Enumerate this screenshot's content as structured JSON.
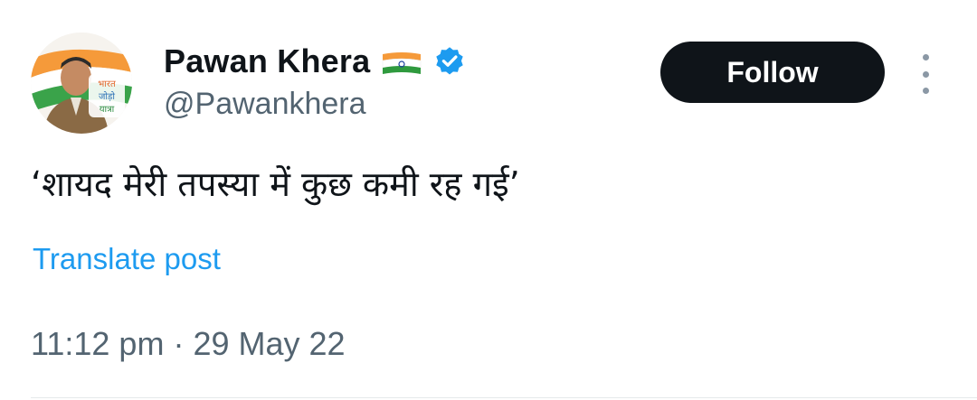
{
  "author": {
    "display_name": "Pawan Khera",
    "flag_emoji_name": "india-flag-icon",
    "verified_icon": "verified-badge-icon",
    "verified_color": "#1d9bf0",
    "handle": "@Pawankhera",
    "avatar": {
      "badge_text_line1": "भारत",
      "badge_text_line2": "जोड़ो",
      "badge_text_line3": "यात्रा"
    }
  },
  "actions": {
    "follow_label": "Follow",
    "more_icon": "more-vertical-icon"
  },
  "post": {
    "text": "‘शायद मेरी तपस्या में कुछ कमी रह गई’",
    "translate_label": "Translate post",
    "time": "11:12 pm",
    "separator": "·",
    "date": "29 May 22"
  },
  "colors": {
    "text_primary": "#0f1419",
    "text_secondary": "#536471",
    "link": "#1d9bf0",
    "button_bg": "#0f1419"
  }
}
